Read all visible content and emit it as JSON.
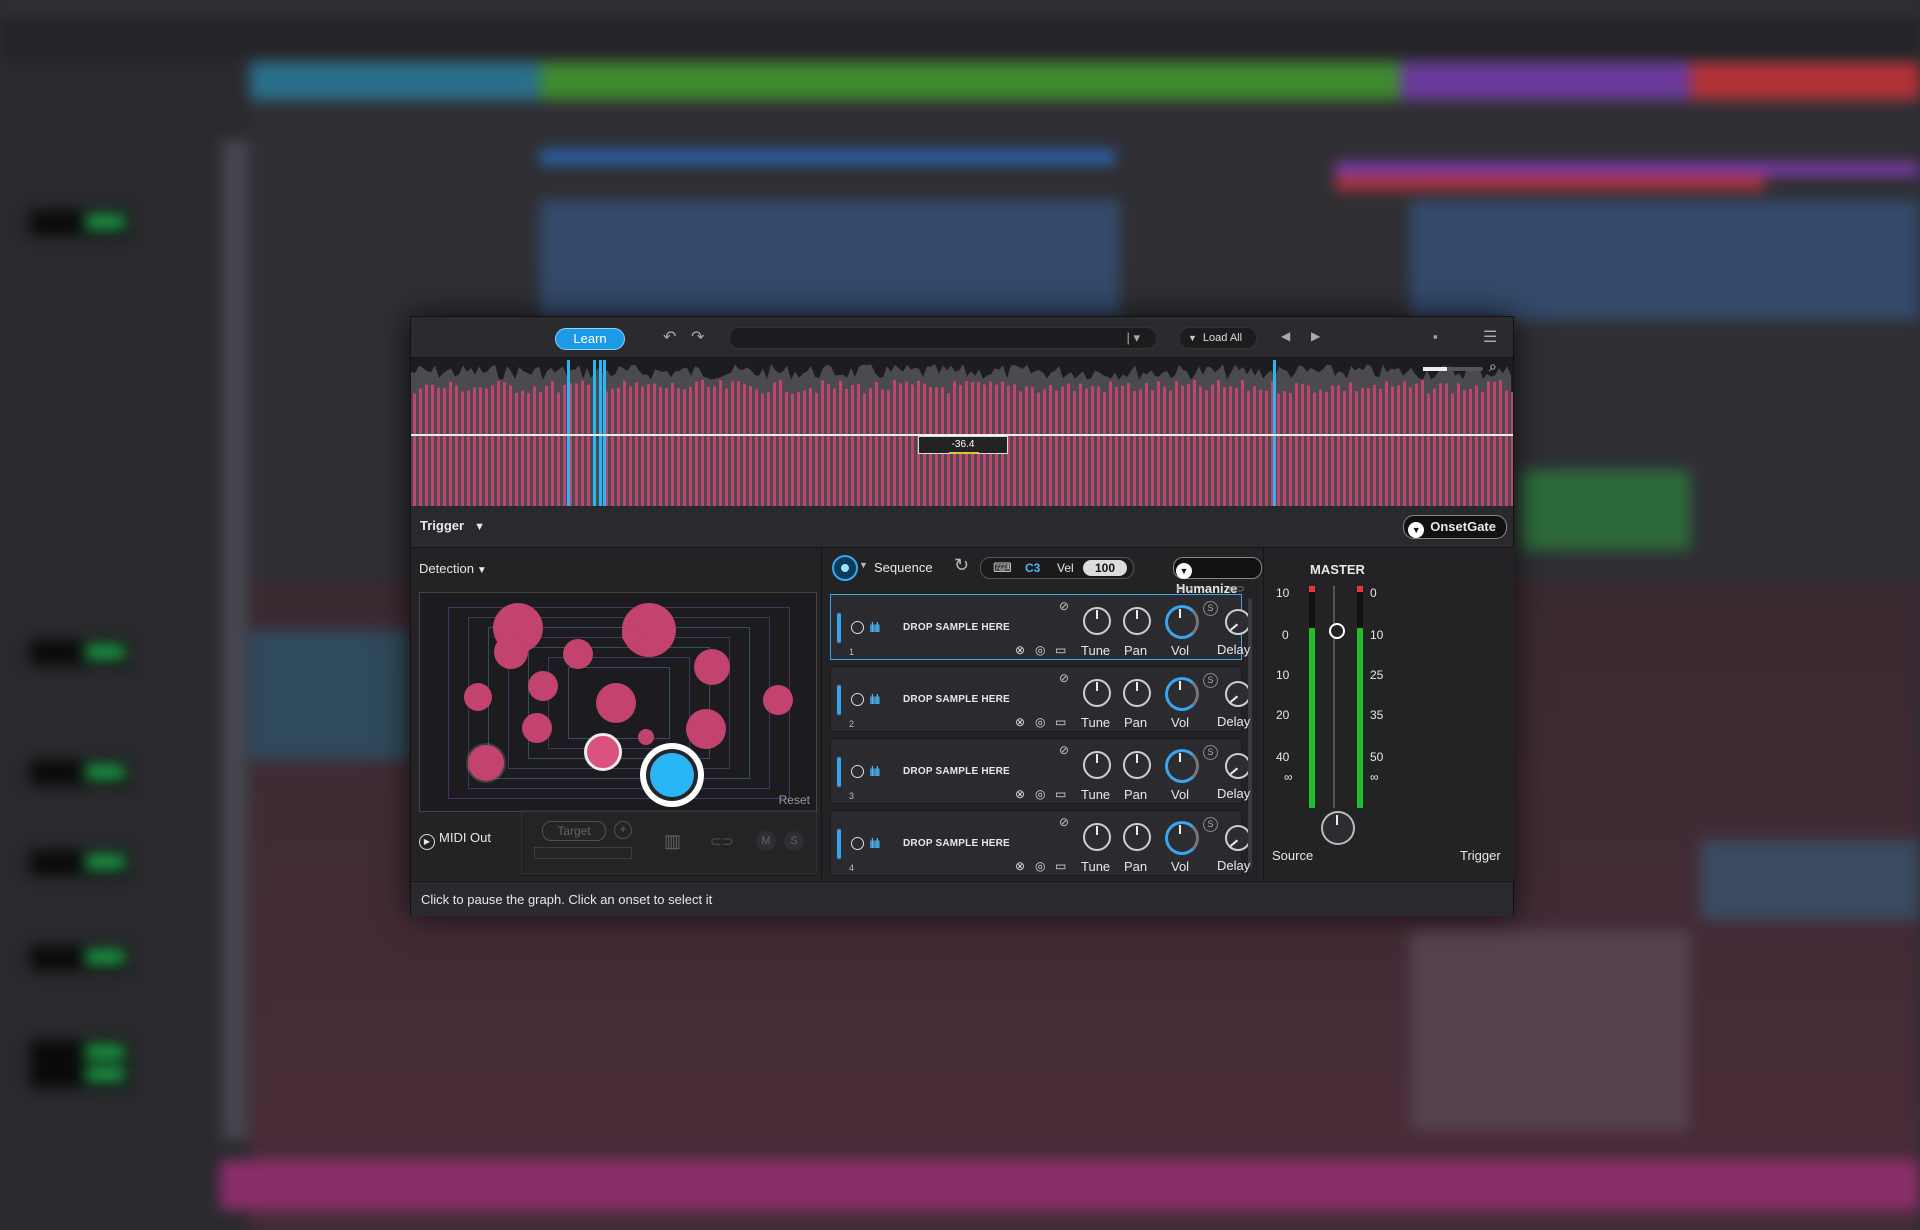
{
  "plugin": {
    "toolbar": {
      "learn_label": "Learn",
      "undo_icon": "undo-icon",
      "redo_icon": "redo-icon",
      "preset_name": "",
      "load_all_label": "Load All",
      "save_icon": "save-icon",
      "menu_icon": "menu-icon"
    },
    "graph": {
      "threshold_value": "-36.4"
    },
    "trigger": {
      "label": "Trigger",
      "mode_label": "OnsetGate"
    },
    "detection": {
      "label": "Detection",
      "reset_label": "Reset",
      "midi_out_label": "MIDI Out",
      "target_label": "Target",
      "mute_label": "M",
      "solo_label": "S"
    },
    "sequence": {
      "label": "Sequence",
      "note": "C3",
      "vel_label": "Vel",
      "vel_value": "100",
      "humanize_label": "Humanize",
      "slots": [
        {
          "num": "1",
          "drop_label": "DROP SAMPLE HERE",
          "tune": "Tune",
          "pan": "Pan",
          "vol": "Vol",
          "delay": "Delay",
          "solo": "S"
        },
        {
          "num": "2",
          "drop_label": "DROP SAMPLE HERE",
          "tune": "Tune",
          "pan": "Pan",
          "vol": "Vol",
          "delay": "Delay",
          "solo": "S"
        },
        {
          "num": "3",
          "drop_label": "DROP SAMPLE HERE",
          "tune": "Tune",
          "pan": "Pan",
          "vol": "Vol",
          "delay": "Delay",
          "solo": "S"
        },
        {
          "num": "4",
          "drop_label": "DROP SAMPLE HERE",
          "tune": "Tune",
          "pan": "Pan",
          "vol": "Vol",
          "delay": "Delay",
          "solo": "S"
        }
      ]
    },
    "master": {
      "title": "MASTER",
      "scale_left": [
        "10",
        "0",
        "10",
        "20",
        "40",
        "∞"
      ],
      "scale_right": [
        "0",
        "10",
        "25",
        "35",
        "50",
        "∞"
      ],
      "source_label": "Source",
      "trigger_label": "Trigger"
    },
    "status_text": "Click to pause the graph. Click an onset to select it"
  },
  "colors": {
    "accent": "#1d9ae6",
    "onset_pink": "#c2436d",
    "onset_blue": "#29b6f6",
    "meter_green": "#1fbf2c"
  }
}
